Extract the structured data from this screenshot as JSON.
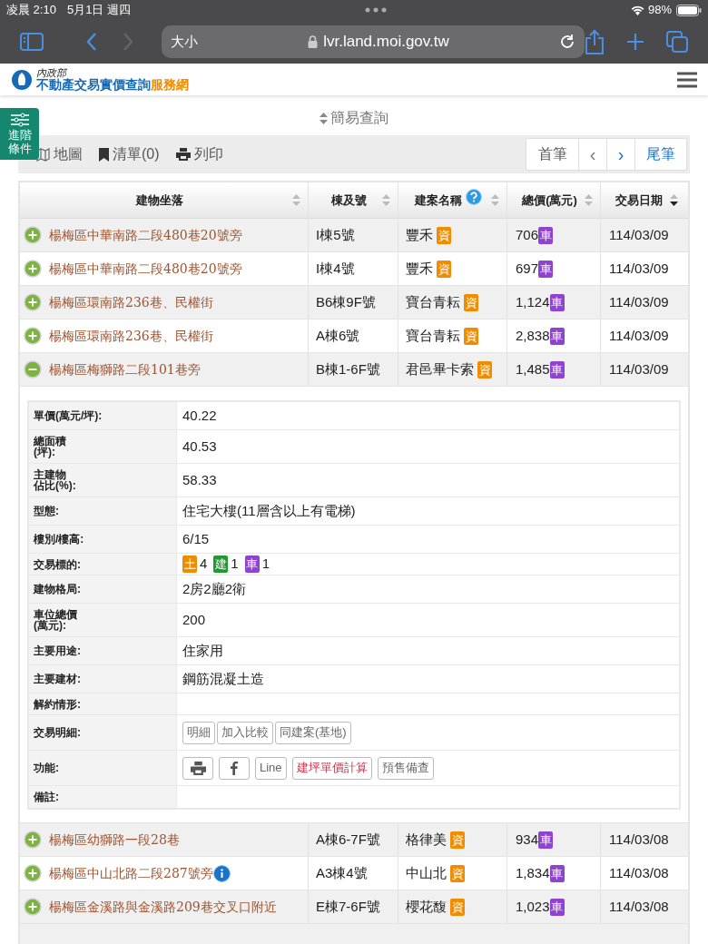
{
  "status_bar": {
    "time": "凌晨 2:10",
    "date": "5月1日 週四",
    "battery": "98%"
  },
  "browser": {
    "text_size": "大小",
    "url": "lvr.land.moi.gov.tw"
  },
  "header": {
    "ministry": "內政部",
    "title": "不動產交易實價查詢",
    "title_suffix": "服務網"
  },
  "side_tab": {
    "label": "進階條件"
  },
  "query_toggle": "簡易查詢",
  "toolbar": {
    "items": [
      "地圖",
      "清單(0)",
      "列印"
    ],
    "pager": [
      "首筆",
      "‹",
      "›",
      "尾筆"
    ]
  },
  "table": {
    "columns": [
      {
        "label": "建物坐落",
        "sorted": false,
        "help": false
      },
      {
        "label": "棟及號",
        "sorted": false,
        "help": false
      },
      {
        "label": "建案名稱",
        "sorted": false,
        "help": true
      },
      {
        "label": "總價(萬元)",
        "sorted": false,
        "help": false
      },
      {
        "label": "交易日期",
        "sorted": true,
        "help": false
      }
    ],
    "rows": [
      {
        "address": "楊梅區中華南路二段480巷20號旁",
        "unit": "I棟5號",
        "project": "豐禾",
        "project_badge": "資",
        "price": "706",
        "price_badge": "車",
        "date": "114/03/09",
        "expanded": false,
        "info": false
      },
      {
        "address": "楊梅區中華南路二段480巷20號旁",
        "unit": "I棟4號",
        "project": "豐禾",
        "project_badge": "資",
        "price": "697",
        "price_badge": "車",
        "date": "114/03/09",
        "expanded": false,
        "info": false
      },
      {
        "address": "楊梅區環南路236巷、民權街",
        "unit": "B6棟9F號",
        "project": "寶台青耘",
        "project_badge": "資",
        "price": "1,124",
        "price_badge": "車",
        "date": "114/03/09",
        "expanded": false,
        "info": false
      },
      {
        "address": "楊梅區環南路236巷、民權街",
        "unit": "A棟6號",
        "project": "寶台青耘",
        "project_badge": "資",
        "price": "2,838",
        "price_badge": "車",
        "date": "114/03/09",
        "expanded": false,
        "info": false
      },
      {
        "address": "楊梅區梅獅路二段101巷旁",
        "unit": "B棟1-6F號",
        "project": "君邑畢卡索",
        "project_badge": "資",
        "price": "1,485",
        "price_badge": "車",
        "date": "114/03/09",
        "expanded": true,
        "info": false,
        "details": [
          {
            "kind": "text",
            "label": [
              "單價(萬元/坪):"
            ],
            "value": "40.22"
          },
          {
            "kind": "text",
            "label": [
              "總面積",
              "(坪):"
            ],
            "value": "40.53"
          },
          {
            "kind": "text",
            "label": [
              "主建物",
              "佔比(%):"
            ],
            "value": "58.33"
          },
          {
            "kind": "text",
            "label": [
              "型態:"
            ],
            "value": "住宅大樓(11層含以上有電梯)"
          },
          {
            "kind": "text",
            "label": [
              "樓別/樓高:"
            ],
            "value": "6/15"
          },
          {
            "kind": "tags",
            "label": [
              "交易標的:"
            ],
            "tags": [
              {
                "tag": "土",
                "count": "4",
                "color": "#f08c00"
              },
              {
                "tag": "建",
                "count": "1",
                "color": "#1e9a2e"
              },
              {
                "tag": "車",
                "count": "1",
                "color": "#8e44cf"
              }
            ]
          },
          {
            "kind": "text",
            "label": [
              "建物格局:"
            ],
            "value": "2房2廳2衛"
          },
          {
            "kind": "text",
            "label": [
              "車位總價",
              "(萬元):"
            ],
            "value": "200"
          },
          {
            "kind": "text",
            "label": [
              "主要用途:"
            ],
            "value": "住家用"
          },
          {
            "kind": "text",
            "label": [
              "主要建材:"
            ],
            "value": "鋼筋混凝土造"
          },
          {
            "kind": "text",
            "label": [
              "解約情形:"
            ]
          },
          {
            "kind": "buttons",
            "label": [
              "交易明細:"
            ],
            "buttons": [
              {
                "kind": "text",
                "label": "明細"
              },
              {
                "kind": "text",
                "label": "加入比較"
              },
              {
                "kind": "text",
                "label": "同建案(基地)"
              }
            ]
          },
          {
            "kind": "buttons",
            "label": [
              "功能:"
            ],
            "buttons": [
              {
                "kind": "print"
              },
              {
                "kind": "facebook"
              },
              {
                "kind": "text",
                "label": "Line"
              },
              {
                "kind": "highlight",
                "label": "建坪單價計算"
              },
              {
                "kind": "text",
                "label": "預售備查"
              }
            ]
          },
          {
            "kind": "text",
            "label": [
              "備註:"
            ]
          }
        ]
      },
      {
        "address": "楊梅區幼獅路一段28巷",
        "unit": "A棟6-7F號",
        "project": "格律美",
        "project_badge": "資",
        "price": "934",
        "price_badge": "車",
        "date": "114/03/08",
        "expanded": false,
        "info": false
      },
      {
        "address": "楊梅區中山北路二段287號旁",
        "unit": "A3棟4號",
        "project": "中山北",
        "project_badge": "資",
        "price": "1,834",
        "price_badge": "車",
        "date": "114/03/08",
        "expanded": false,
        "info": true
      },
      {
        "address": "楊梅區金溪路與金溪路209巷交叉口附近",
        "unit": "E棟7-6F號",
        "project": "櫻花馥",
        "project_badge": "資",
        "price": "1,023",
        "price_badge": "車",
        "date": "114/03/08",
        "expanded": false,
        "info": false
      }
    ]
  }
}
